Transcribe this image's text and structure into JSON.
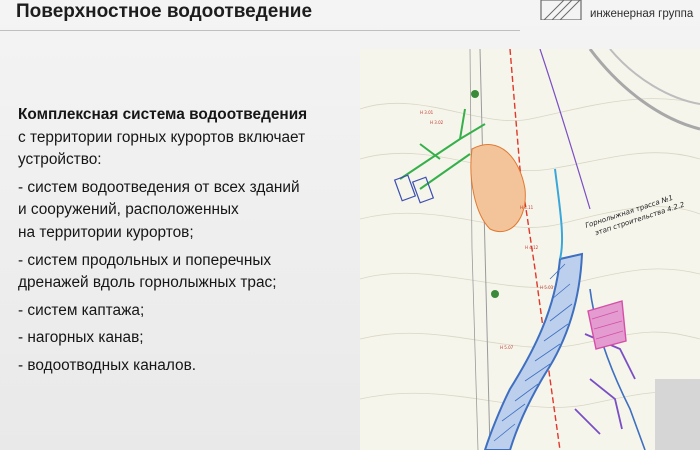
{
  "header": {
    "title": "Поверхностное водоотведение"
  },
  "logo": {
    "caption": "инженерная группа",
    "icon": "company-logo-icon"
  },
  "content": {
    "heading": "Комплексная система водоотведения",
    "intro_lines": [
      "с территории горных курортов включает",
      "устройство:"
    ],
    "items": [
      [
        "- систем водоотведения от всех зданий",
        "и сооружений, расположенных",
        "на территории курортов;"
      ],
      [
        "- систем продольных и поперечных",
        "дренажей вдоль горнолыжных трас;"
      ],
      [
        "- систем каптажа;"
      ],
      [
        "- нагорных канав;"
      ],
      [
        "- водоотводных каналов."
      ]
    ]
  },
  "map": {
    "label_line1": "Горнолыжная трасса №1",
    "label_line2": "этап строительства 4.2.2",
    "colors": {
      "channel": "#3f6fbf",
      "drain": "#35b04a",
      "boundary": "#e0392b",
      "culvert": "#7a4fc4",
      "zone": "#d54fa8",
      "slope": "#f0a35e"
    }
  }
}
